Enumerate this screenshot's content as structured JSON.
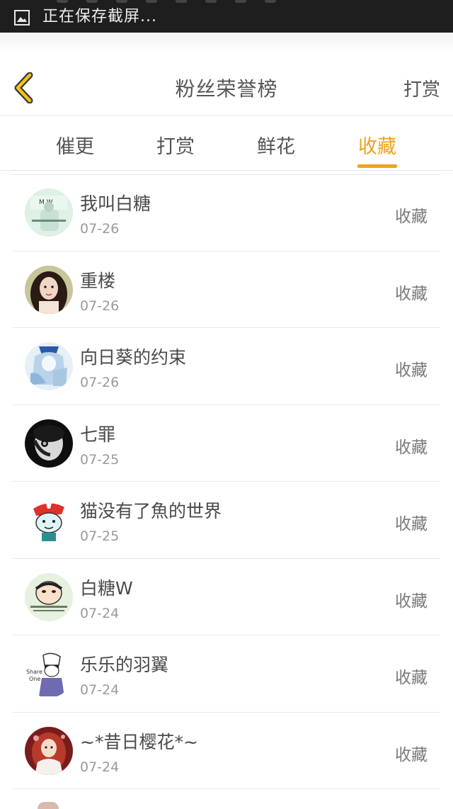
{
  "status_bar": {
    "notification_text": "正在保存截屏...",
    "icon": "image-icon"
  },
  "header": {
    "title": "粉丝荣誉榜",
    "back_icon": "chevron-left-icon",
    "action_label": "打赏",
    "accent_color": "#f0a21e"
  },
  "tabs": [
    {
      "label": "催更",
      "active": false
    },
    {
      "label": "打赏",
      "active": false
    },
    {
      "label": "鲜花",
      "active": false
    },
    {
      "label": "收藏",
      "active": true
    }
  ],
  "list": [
    {
      "name": "我叫白糖",
      "date": "07-26",
      "action": "收藏",
      "avatar": "avatar-icon"
    },
    {
      "name": "重楼",
      "date": "07-26",
      "action": "收藏",
      "avatar": "avatar-icon"
    },
    {
      "name": "向日葵的约束",
      "date": "07-26",
      "action": "收藏",
      "avatar": "avatar-icon"
    },
    {
      "name": "七罪",
      "date": "07-25",
      "action": "收藏",
      "avatar": "avatar-icon"
    },
    {
      "name": "猫没有了魚的世界",
      "date": "07-25",
      "action": "收藏",
      "avatar": "avatar-icon"
    },
    {
      "name": "白糖W",
      "date": "07-24",
      "action": "收藏",
      "avatar": "avatar-icon"
    },
    {
      "name": "乐乐的羽翼",
      "date": "07-24",
      "action": "收藏",
      "avatar": "avatar-icon"
    },
    {
      "name": "~*昔日樱花*~",
      "date": "07-24",
      "action": "收藏",
      "avatar": "avatar-icon"
    }
  ]
}
